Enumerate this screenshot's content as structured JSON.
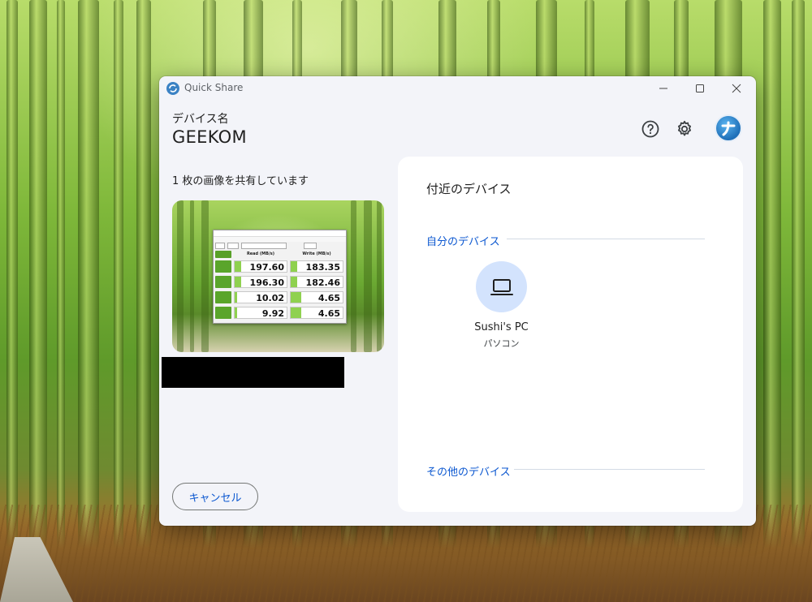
{
  "window": {
    "title": "Quick Share"
  },
  "device": {
    "label": "デバイス名",
    "name": "GEEKOM"
  },
  "share": {
    "status": "1 枚の画像を共有しています",
    "preview": {
      "headers": [
        "Read (MB/s)",
        "Write (MB/s)"
      ],
      "rows": [
        {
          "read": "197.60",
          "write": "183.35"
        },
        {
          "read": "196.30",
          "write": "182.46"
        },
        {
          "read": "10.02",
          "write": "4.65"
        },
        {
          "read": "9.92",
          "write": "4.65"
        }
      ]
    }
  },
  "actions": {
    "cancel_label": "キャンセル"
  },
  "nearby": {
    "title": "付近のデバイス",
    "own_section": "自分のデバイス",
    "other_section": "その他のデバイス",
    "devices": [
      {
        "name": "Sushi's PC",
        "type": "パソコン",
        "icon": "laptop-icon"
      }
    ]
  },
  "colors": {
    "accent": "#0b57d0",
    "device_circle": "#d3e3fd",
    "panel": "#ffffff",
    "window_bg": "#f3f4f9"
  }
}
